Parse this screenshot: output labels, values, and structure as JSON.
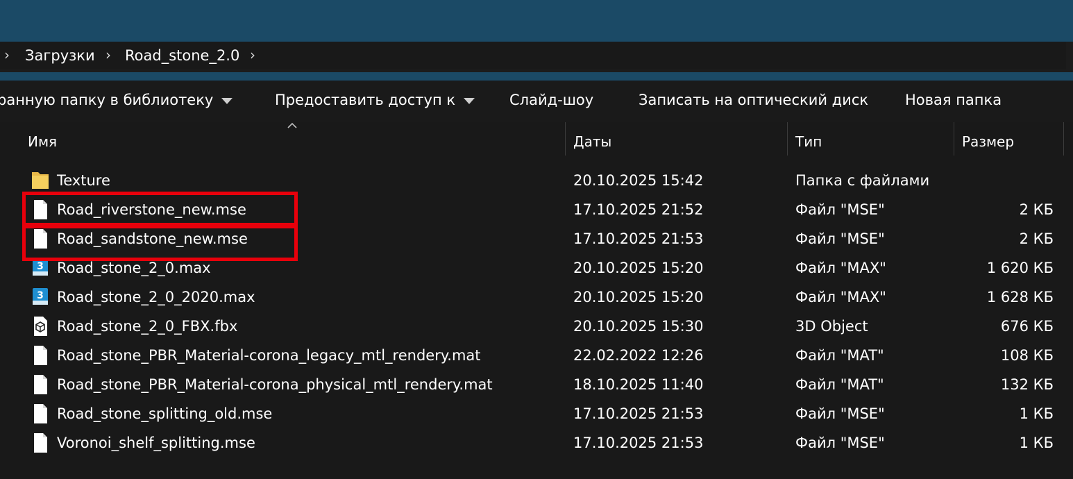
{
  "breadcrumb": [
    "Загрузки",
    "Road_stone_2.0"
  ],
  "commands": [
    {
      "label": "ранную папку в библиотеку",
      "dropdown": true
    },
    {
      "label": "Предоставить доступ к",
      "dropdown": true
    },
    {
      "label": "Слайд-шоу",
      "dropdown": false
    },
    {
      "label": "Записать на оптический диск",
      "dropdown": false
    },
    {
      "label": "Новая папка",
      "dropdown": false
    }
  ],
  "columns": {
    "name": "Имя",
    "date": "Даты",
    "type": "Тип",
    "size": "Размер"
  },
  "files": [
    {
      "name": "Texture",
      "date": "20.10.2025 15:42",
      "type": "Папка с файлами",
      "size": "",
      "icon": "folder-icon"
    },
    {
      "name": "Road_riverstone_new.mse",
      "date": "17.10.2025 21:52",
      "type": "Файл \"MSE\"",
      "size": "2 КБ",
      "icon": "file-icon"
    },
    {
      "name": "Road_sandstone_new.mse",
      "date": "17.10.2025 21:53",
      "type": "Файл \"MSE\"",
      "size": "2 КБ",
      "icon": "file-icon"
    },
    {
      "name": "Road_stone_2_0.max",
      "date": "20.10.2025 15:20",
      "type": "Файл \"MAX\"",
      "size": "1 620 КБ",
      "icon": "3dsmax-icon"
    },
    {
      "name": "Road_stone_2_0_2020.max",
      "date": "20.10.2025 15:20",
      "type": "Файл \"MAX\"",
      "size": "1 628 КБ",
      "icon": "3dsmax-icon"
    },
    {
      "name": "Road_stone_2_0_FBX.fbx",
      "date": "20.10.2025 15:30",
      "type": "3D Object",
      "size": "676 КБ",
      "icon": "3d-object-icon"
    },
    {
      "name": "Road_stone_PBR_Material-corona_legacy_mtl_rendery.mat",
      "date": "22.02.2022 12:26",
      "type": "Файл \"MAT\"",
      "size": "108 КБ",
      "icon": "file-icon"
    },
    {
      "name": "Road_stone_PBR_Material-corona_physical_mtl_rendery.mat",
      "date": "18.10.2025 11:40",
      "type": "Файл \"MAT\"",
      "size": "132 КБ",
      "icon": "file-icon"
    },
    {
      "name": "Road_stone_splitting_old.mse",
      "date": "17.10.2025 21:53",
      "type": "Файл \"MSE\"",
      "size": "1 КБ",
      "icon": "file-icon"
    },
    {
      "name": "Voronoi_shelf_splitting.mse",
      "date": "17.10.2025 21:53",
      "type": "Файл \"MSE\"",
      "size": "1 КБ",
      "icon": "file-icon"
    }
  ],
  "colors": {
    "title_bar": "#1b4a66",
    "background": "#191919",
    "highlight": "#e8000b"
  }
}
